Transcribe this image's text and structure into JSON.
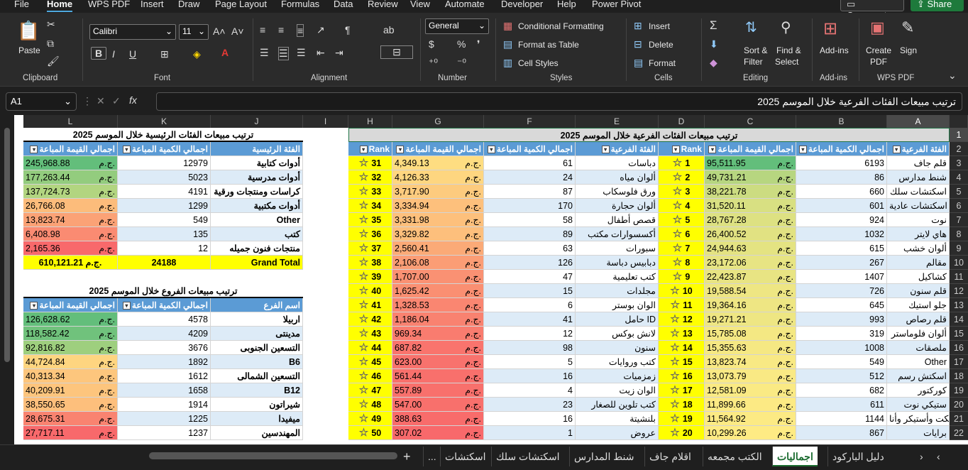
{
  "menu": [
    "File",
    "Home",
    "WPS PDF",
    "Insert",
    "Draw",
    "Page Layout",
    "Formulas",
    "Data",
    "Review",
    "View",
    "Automate",
    "Developer",
    "Help",
    "Power Pivot"
  ],
  "menu_active": "Home",
  "comments_label": "Comments",
  "share_label": "Share",
  "ribbon": {
    "clipboard": {
      "paste": "Paste",
      "label": "Clipboard"
    },
    "font": {
      "name": "Calibri",
      "size": "11",
      "label": "Font"
    },
    "alignment": {
      "label": "Alignment"
    },
    "number": {
      "format": "General",
      "label": "Number"
    },
    "styles": {
      "cond": "Conditional Formatting",
      "table": "Format as Table",
      "cell": "Cell Styles",
      "label": "Styles"
    },
    "cells": {
      "insert": "Insert",
      "delete": "Delete",
      "format": "Format",
      "label": "Cells"
    },
    "editing": {
      "sort": "Sort &",
      "sort2": "Filter",
      "find": "Find &",
      "find2": "Select",
      "label": "Editing"
    },
    "addins": {
      "btn": "Add-ins",
      "label": "Add-ins"
    },
    "wps": {
      "create": "Create",
      "create2": "PDF",
      "sign": "Sign",
      "label": "WPS PDF"
    }
  },
  "formula": {
    "cell_ref": "A1",
    "content": "ترتيب مبيعات الفئات الفرعية خلال الموسم 2025"
  },
  "columns": [
    "A",
    "B",
    "C",
    "D",
    "E",
    "F",
    "G",
    "H",
    "I",
    "J",
    "K",
    "L"
  ],
  "rows": [
    "1",
    "2",
    "3",
    "4",
    "5",
    "6",
    "7",
    "8",
    "9",
    "10",
    "11",
    "12",
    "13",
    "14",
    "15",
    "16",
    "17",
    "18",
    "19",
    "20",
    "21",
    "22"
  ],
  "main_table": {
    "title": "ترتيب مبيعات الفئات الفرعية خلال الموسم 2025",
    "headers": [
      "الفئة الفرعية",
      "اجمالي الكمية المباعة",
      "اجمالي القيمة المباعة",
      "Rank",
      "الفئة الفرعية",
      "اجمالي الكمية المباعة",
      "اجمالي القيمة المباعة",
      "Rank"
    ],
    "currency": "ج.م.",
    "left_rows": [
      [
        "قلم جاف",
        "6193",
        "95,511.95",
        "1"
      ],
      [
        "شنط مدارس",
        "86",
        "49,731.21",
        "2"
      ],
      [
        "اسكتشات سلك",
        "660",
        "38,221.78",
        "3"
      ],
      [
        "اسكتشات عادية",
        "601",
        "31,520.11",
        "4"
      ],
      [
        "نوت",
        "924",
        "28,767.28",
        "5"
      ],
      [
        "هاي لايتر",
        "1032",
        "26,400.52",
        "6"
      ],
      [
        "ألوان خشب",
        "615",
        "24,944.63",
        "7"
      ],
      [
        "مقالم",
        "267",
        "23,172.06",
        "8"
      ],
      [
        "كشاكيل",
        "1407",
        "22,423.87",
        "9"
      ],
      [
        "قلم سنون",
        "726",
        "19,588.54",
        "10"
      ],
      [
        "جلو استيك",
        "645",
        "19,364.16",
        "11"
      ],
      [
        "قلم رصاص",
        "993",
        "19,271.21",
        "12"
      ],
      [
        "ألوان فلوماستر",
        "319",
        "15,785.08",
        "13"
      ],
      [
        "ملصقات",
        "1008",
        "15,355.63",
        "14"
      ],
      [
        "Other",
        "549",
        "13,823.74",
        "15"
      ],
      [
        "اسكتش رسم",
        "512",
        "13,073.79",
        "16"
      ],
      [
        "كوركتور",
        "682",
        "12,581.09",
        "17"
      ],
      [
        "ستيكي نوت",
        "611",
        "11,899.66",
        "18"
      ],
      [
        "تكت وأستيكر وأنا",
        "1144",
        "11,564.92",
        "19"
      ],
      [
        "برايات",
        "867",
        "10,299.26",
        "20"
      ]
    ],
    "right_rows": [
      [
        "دباسات",
        "61",
        "4,349.13",
        "31"
      ],
      [
        "ألوان مياه",
        "24",
        "4,126.33",
        "32"
      ],
      [
        "ورق فلوسكاب",
        "87",
        "3,717.90",
        "33"
      ],
      [
        "ألوان حجارة",
        "170",
        "3,334.94",
        "34"
      ],
      [
        "قصص أطفال",
        "58",
        "3,331.98",
        "35"
      ],
      [
        "أكسسوارات مكتب",
        "89",
        "3,329.82",
        "36"
      ],
      [
        "سبورات",
        "63",
        "2,560.41",
        "37"
      ],
      [
        "دبابيس دباسة",
        "126",
        "2,106.08",
        "38"
      ],
      [
        "كتب تعليمية",
        "47",
        "1,707.00",
        "39"
      ],
      [
        "مجلدات",
        "15",
        "1,625.42",
        "40"
      ],
      [
        "الوان بوستر",
        "6",
        "1,328.53",
        "41"
      ],
      [
        "حامل ID",
        "41",
        "1,186.04",
        "42"
      ],
      [
        "لانش بوكس",
        "12",
        "969.34",
        "43"
      ],
      [
        "سنون",
        "98",
        "687.82",
        "44"
      ],
      [
        "كتب وروايات",
        "5",
        "623.00",
        "45"
      ],
      [
        "زمزميات",
        "16",
        "561.44",
        "46"
      ],
      [
        "الوان زيت",
        "4",
        "557.89",
        "47"
      ],
      [
        "كتب تلوين للصغار",
        "23",
        "547.00",
        "48"
      ],
      [
        "بلنشيتة",
        "16",
        "388.63",
        "49"
      ],
      [
        "عروض",
        "1",
        "307.02",
        "50"
      ]
    ]
  },
  "cat_table": {
    "title": "ترتيب مبيعات الفئات الرئيسية خلال الموسم 2025",
    "headers": [
      "الفئة الرئيسية",
      "اجمالي الكمية المباعة",
      "اجمالي القيمة المباعة"
    ],
    "rows": [
      [
        "أدوات كتابية",
        "12979",
        "245,968.88"
      ],
      [
        "أدوات مدرسية",
        "5023",
        "177,263.44"
      ],
      [
        "كراسات ومنتجات ورقية",
        "4191",
        "137,724.73"
      ],
      [
        "أدوات مكتبية",
        "1299",
        "26,766.08"
      ],
      [
        "Other",
        "549",
        "13,823.74"
      ],
      [
        "كتب",
        "135",
        "6,408.98"
      ],
      [
        "منتجات فنون جميله",
        "12",
        "2,165.36"
      ]
    ],
    "total": [
      "Grand Total",
      "24188",
      "610,121.21"
    ]
  },
  "branch_table": {
    "title": "ترتيب مبيعات الفروع خلال الموسم 2025",
    "headers": [
      "اسم الفرع",
      "اجمالي الكمية المباعة",
      "اجمالي القيمة المباعة"
    ],
    "rows": [
      [
        "اربيلا",
        "4578",
        "126,628.62"
      ],
      [
        "مدينتى",
        "4209",
        "118,582.42"
      ],
      [
        "التسعين الجنوبى",
        "3676",
        "92,816.82"
      ],
      [
        "B6",
        "1892",
        "44,724.84"
      ],
      [
        "التسعين الشمالى",
        "1612",
        "40,313.34"
      ],
      [
        "B12",
        "1658",
        "40,209.91"
      ],
      [
        "شيراتون",
        "1914",
        "38,550.65"
      ],
      [
        "ميفيدا",
        "1225",
        "28,675.31"
      ],
      [
        "المهندسين",
        "1237",
        "27,717.11"
      ]
    ]
  },
  "tabs": [
    "دليل الباركود",
    "اجماليات",
    "الكتب مجمعه",
    "اقلام جاف",
    "شنط المدارس",
    "اسكتشات سلك",
    "اسكتشات",
    "..."
  ],
  "tab_active": "اجماليات",
  "colors": {
    "header_blue": "#5b9bd5",
    "rank_yellow": "#ffff00",
    "green": "#63be7b",
    "red": "#f8696b"
  }
}
